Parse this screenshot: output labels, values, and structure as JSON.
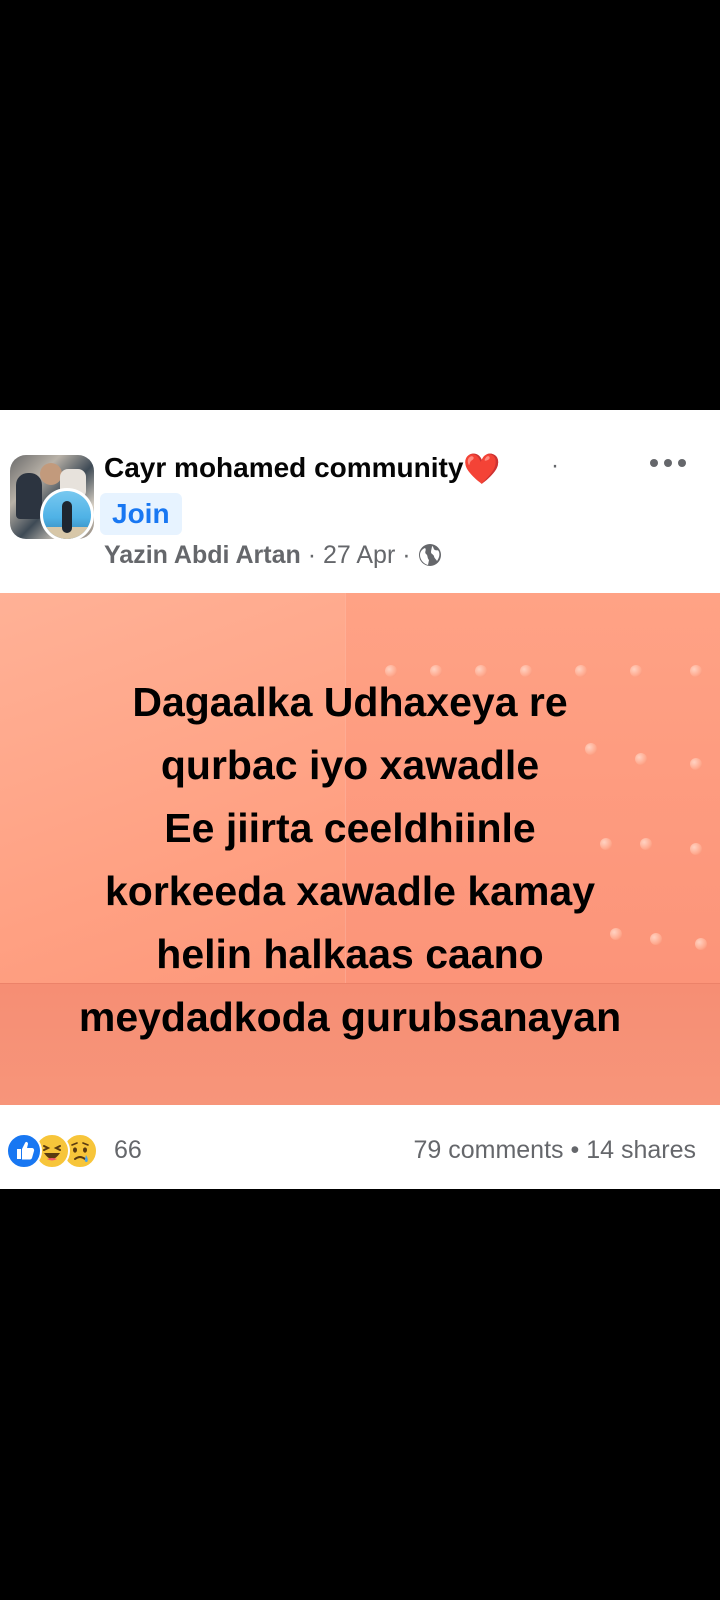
{
  "post": {
    "group_name": "Cayr mohamed community",
    "heart_emoji": "❤️",
    "separator": "·",
    "join_label": "Join",
    "author": "Yazin Abdi Artan",
    "date": "27 Apr",
    "meta_separator": " · ",
    "privacy_icon": "globe-icon",
    "more_icon": "more-options-icon",
    "body_lines": [
      "Dagaalka Udhaxeya re",
      "qurbac iyo xawadle",
      "Ee jiirta ceeldhiinle",
      "korkeeda xawadle kamay",
      "helin halkaas caano",
      "meydadkoda gurubsanayan"
    ],
    "background_color": "#ffa082"
  },
  "engagement": {
    "reaction_icons": [
      "like-icon",
      "haha-icon",
      "sad-icon"
    ],
    "reaction_count": "66",
    "comments": "79 comments",
    "bullet": "•",
    "shares": "14 shares"
  },
  "colors": {
    "accent": "#1877f2",
    "join_bg": "#e7f3ff",
    "meta_text": "#65676b"
  }
}
